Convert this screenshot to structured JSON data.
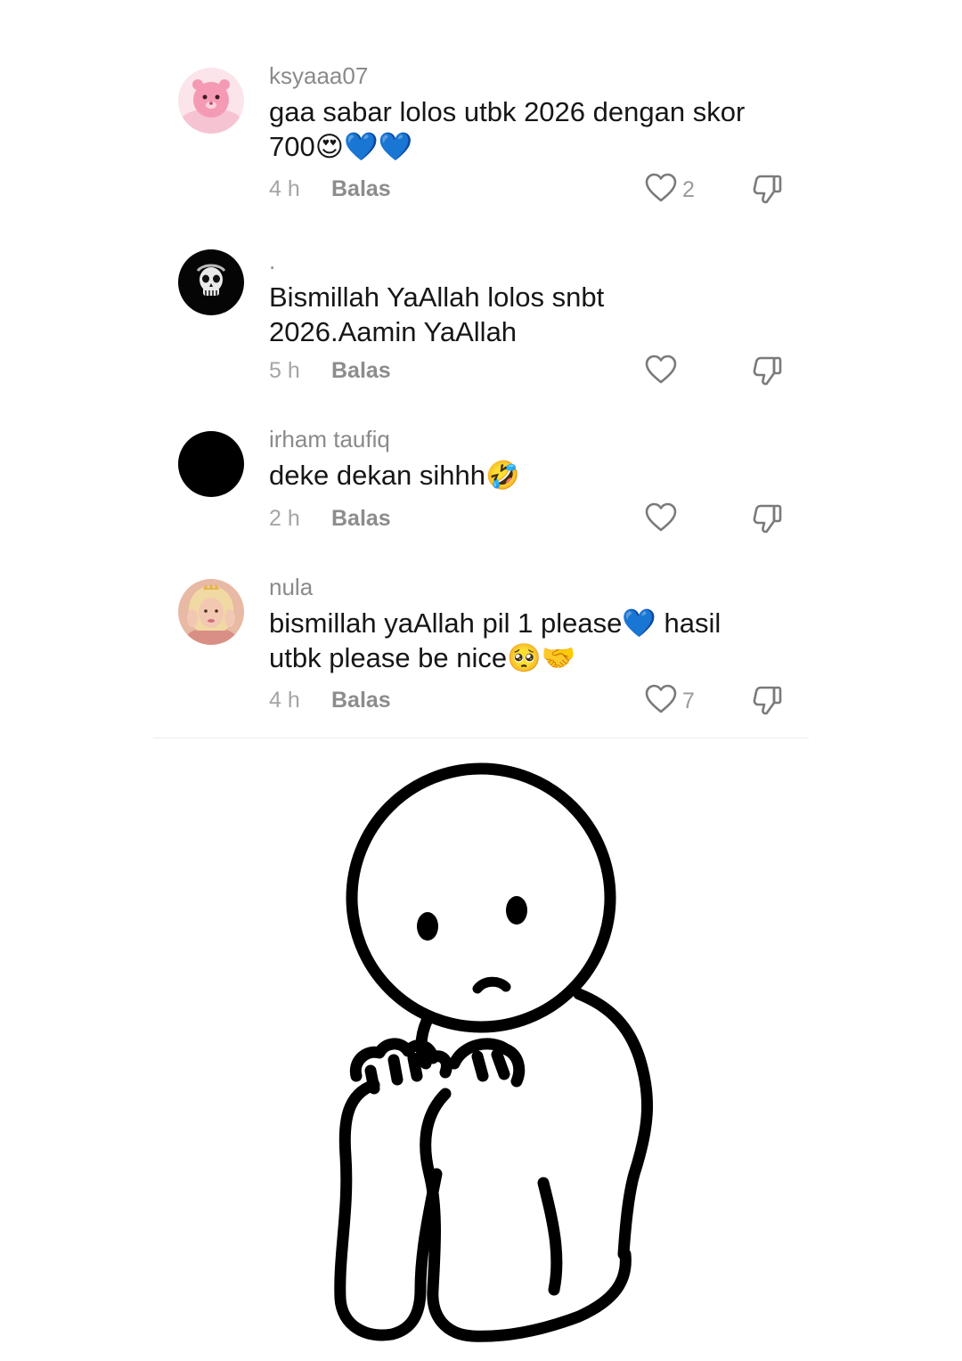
{
  "comments": [
    {
      "username": "ksyaaa07",
      "text": "gaa sabar lolos utbk 2026 dengan skor\n700😍💙💙",
      "time": "4 h",
      "reply_label": "Balas",
      "likes": "2",
      "avatar": "pink-character-avatar"
    },
    {
      "username": ".",
      "text": "Bismillah YaAllah lolos snbt\n2026.Aamin YaAllah",
      "time": "5 h",
      "reply_label": "Balas",
      "likes": "",
      "avatar": "skull-avatar"
    },
    {
      "username": "irham taufiq",
      "text": "deke dekan sihhh🤣",
      "time": "2 h",
      "reply_label": "Balas",
      "likes": "",
      "avatar": "black-avatar"
    },
    {
      "username": "nula",
      "text": "bismillah yaAllah pil 1 please💙 hasil\nutbk please be nice🥺🤝",
      "time": "4 h",
      "reply_label": "Balas",
      "likes": "7",
      "avatar": "photo-avatar"
    }
  ],
  "colors": {
    "username": "#8a8a8a",
    "text": "#161616",
    "meta": "#9a9a9a",
    "avatar_pink": "#f7b6c8",
    "avatar_dark": "#000000"
  },
  "icons": [
    "heart-outline-icon",
    "thumbs-down-icon"
  ]
}
